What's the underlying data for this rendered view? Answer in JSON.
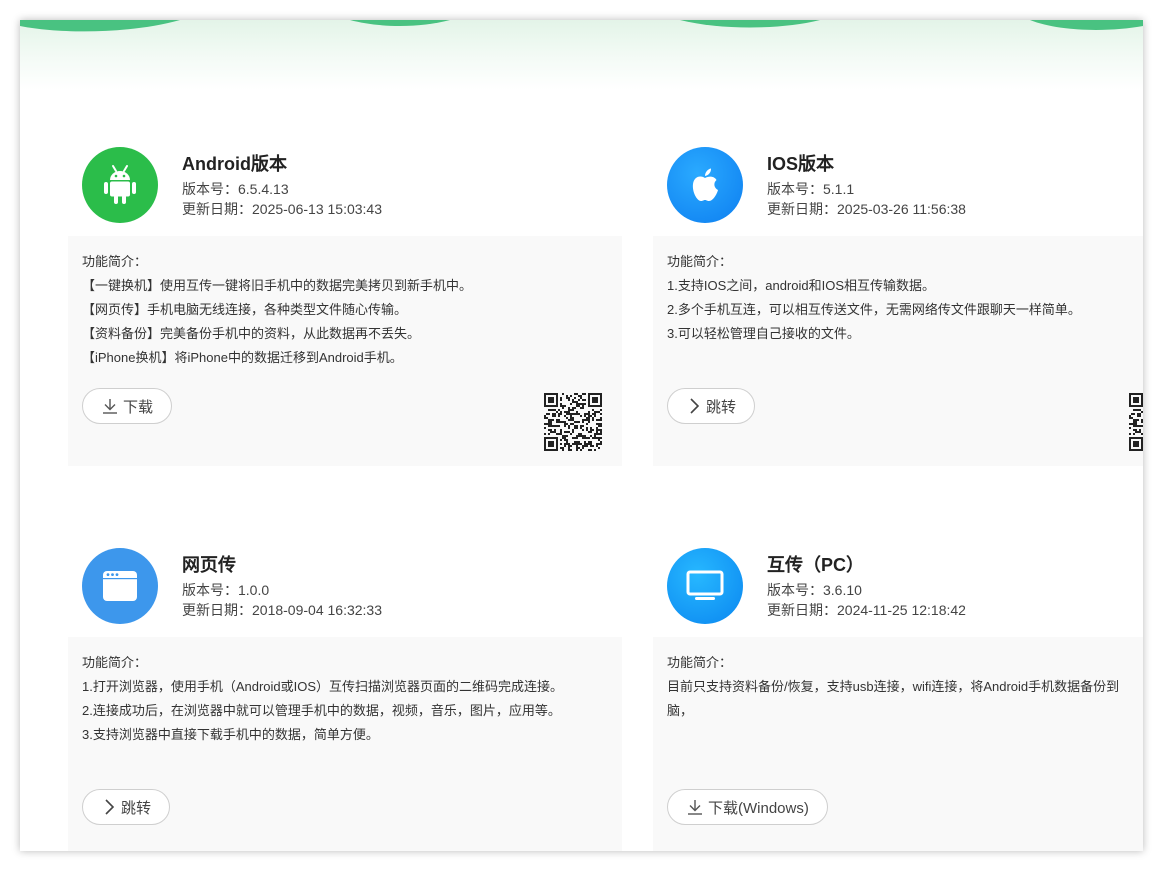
{
  "cards": [
    {
      "title": "Android版本",
      "version": "版本号：6.5.4.13",
      "updated": "更新日期：2025-06-13 15:03:43",
      "icon": "android-icon",
      "icon_color": "#2bbd4a",
      "desc_heading": "功能简介：",
      "desc": [
        "【一键换机】使用互传一键将旧手机中的数据完美拷贝到新手机中。",
        "【网页传】手机电脑无线连接，各种类型文件随心传输。",
        "【资料备份】完美备份手机中的资料，从此数据再不丢失。",
        "【iPhone换机】将iPhone中的数据迁移到Android手机。"
      ],
      "button": "下载",
      "button_icon": "download-icon",
      "qr": true
    },
    {
      "title": "IOS版本",
      "version": "版本号：5.1.1",
      "updated": "更新日期：2025-03-26 11:56:38",
      "icon": "apple-icon",
      "icon_color": "#1a8ff5",
      "desc_heading": "功能简介：",
      "desc": [
        "1.支持IOS之间，android和IOS相互传输数据。",
        "2.多个手机互连，可以相互传送文件，无需网络传文件跟聊天一样简单。",
        "3.可以轻松管理自己接收的文件。"
      ],
      "button": "跳转",
      "button_icon": "chevron-right-icon",
      "qr": true
    },
    {
      "title": "网页传",
      "version": "版本号：1.0.0",
      "updated": "更新日期：2018-09-04 16:32:33",
      "icon": "browser-window-icon",
      "icon_color": "#3d97ec",
      "desc_heading": "功能简介：",
      "desc": [
        "1.打开浏览器，使用手机（Android或IOS）互传扫描浏览器页面的二维码完成连接。",
        "2.连接成功后，在浏览器中就可以管理手机中的数据，视频，音乐，图片，应用等。",
        "3.支持浏览器中直接下载手机中的数据，简单方便。"
      ],
      "button": "跳转",
      "button_icon": "chevron-right-icon",
      "qr": false
    },
    {
      "title": "互传（PC）",
      "version": "版本号：3.6.10",
      "updated": "更新日期：2024-11-25 12:18:42",
      "icon": "monitor-icon",
      "icon_color": "#1a9ef5",
      "desc_heading": "功能简介：",
      "desc": [
        "目前只支持资料备份/恢复，支持usb连接，wifi连接，将Android手机数据备份到",
        "脑，"
      ],
      "button": "下载(Windows)",
      "button_icon": "download-icon",
      "qr": false
    }
  ]
}
